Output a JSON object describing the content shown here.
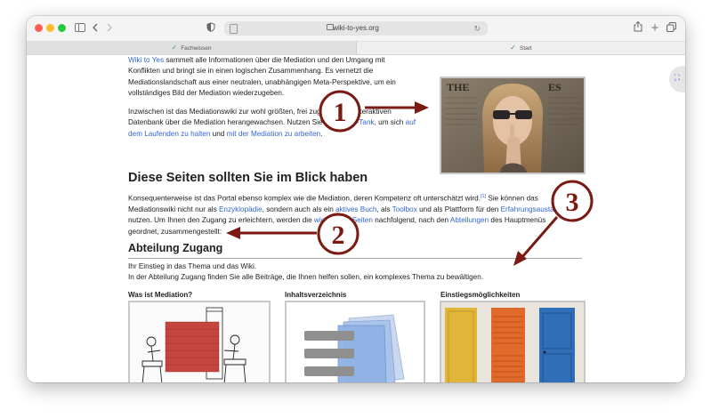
{
  "browser": {
    "url": "wiki-to-yes.org",
    "tabs": [
      {
        "label": "Fachwissen"
      },
      {
        "label": "Start"
      }
    ]
  },
  "intro": {
    "p1_link": "Wiki to Yes",
    "p1_text_a": " sammelt alle Informationen über die Mediation und den Umgang mit",
    "p1_line2": "Konflikten und bringt sie in einen logischen Zusammenhang. Es vernetzt die",
    "p1_line3": "Mediationslandschaft aus einer neutralen, unabhängigen Meta-Perspektive, um ein",
    "p1_line4": "vollständiges Bild der Mediation wiederzugeben.",
    "p2_line1": "Inzwischen ist das Mediationswiki zur wohl größten, frei zugänglichen interaktiven",
    "p2_line2_a": "Datenbank über die Mediation herangewachsen. Nutzen Sie den ",
    "p2_line2_link": "Think-Tank",
    "p2_line2_b": ", um sich ",
    "p2_line2_link2": "auf",
    "p2_line3_link": "dem Laufenden zu halten",
    "p2_line3_a": " und ",
    "p2_line3_link2": "mit der Mediation zu arbeiten",
    "p2_line3_b": "."
  },
  "section_main": {
    "heading": "Diese Seiten sollten Sie im Blick haben",
    "l1_a": "Konsequenterweise ist das Portal ebenso komplex wie die Mediation, deren Kompetenz oft unterschätzt wird.",
    "l1_ref": "[1]",
    "l1_b": " Sie können das",
    "l2_a": "Mediationswiki nicht nur als ",
    "l2_link1": "Enzyklopädie",
    "l2_b": ", sondern auch als ein ",
    "l2_link2": "aktives Buch",
    "l2_c": ", als ",
    "l2_link3": "Toolbox",
    "l2_d": " und als Plattform für den ",
    "l2_link4": "Erfahrungsaustausch",
    "l3_a": "nutzen. Um Ihnen den Zugang zu erleichtern, werden die ",
    "l3_link1": "wichtigsten Seiten",
    "l3_b": " nachfolgend, nach den ",
    "l3_link2": "Abteilungen",
    "l3_c": " des Hauptmenüs",
    "l4": "geordnet, zusammengestellt:"
  },
  "section_zugang": {
    "heading": "Abteilung Zugang",
    "l1": "Ihr Einstieg in das Thema und das Wiki.",
    "l2": "In der Abteilung Zugang finden Sie alle Beiträge, die Ihnen helfen sollen, ein komplexes Thema zu bewältigen.",
    "columns": [
      {
        "title": "Was ist Mediation?"
      },
      {
        "title": "Inhaltsverzeichnis"
      },
      {
        "title": "Einstiegsmöglichkeiten"
      }
    ]
  },
  "annotations": [
    {
      "number": "1"
    },
    {
      "number": "2"
    },
    {
      "number": "3"
    }
  ],
  "colors": {
    "link": "#3366cc",
    "annotation": "#7a1a12",
    "text": "#202122"
  }
}
